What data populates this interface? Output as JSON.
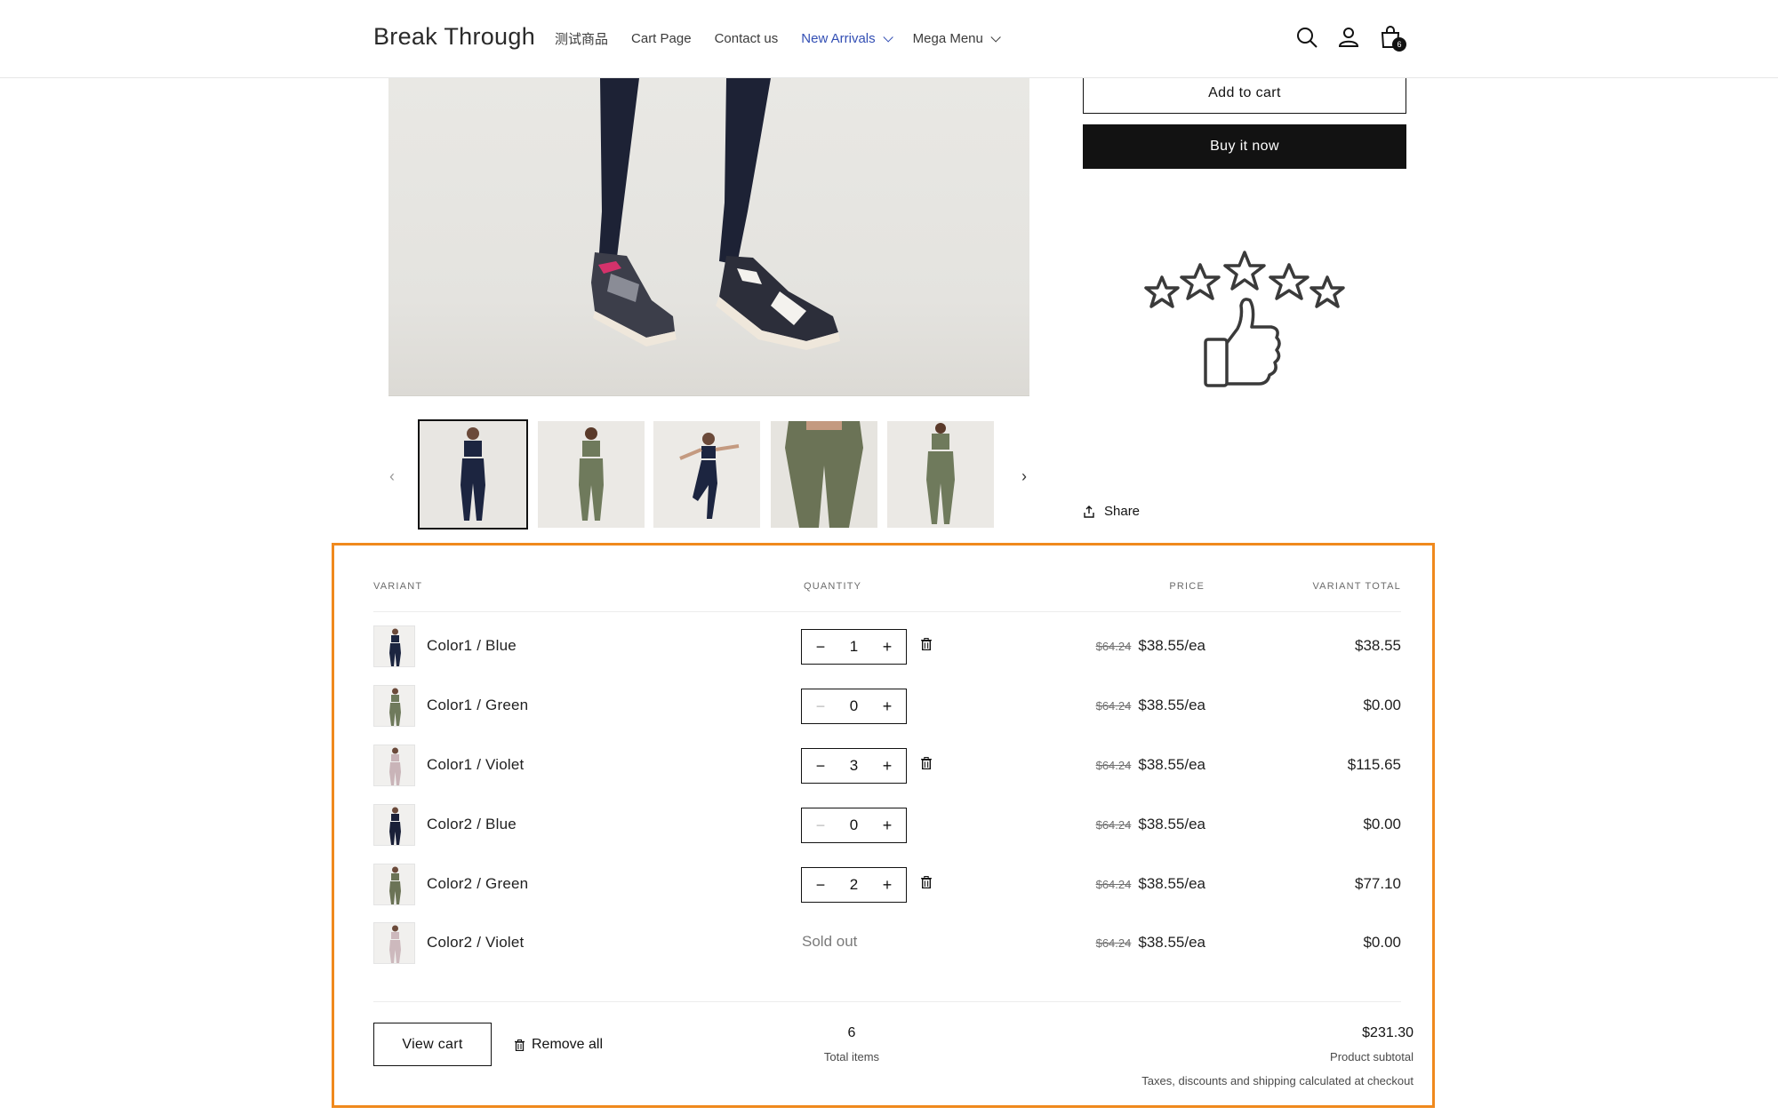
{
  "header": {
    "logo": "Break Through",
    "nav": [
      {
        "label": "测试商品",
        "active": false,
        "dropdown": false
      },
      {
        "label": "Cart Page",
        "active": false,
        "dropdown": false
      },
      {
        "label": "Contact us",
        "active": false,
        "dropdown": false
      },
      {
        "label": "New Arrivals",
        "active": true,
        "dropdown": true
      },
      {
        "label": "Mega Menu",
        "active": false,
        "dropdown": true
      }
    ],
    "icons": [
      "search-icon",
      "account-icon",
      "cart-icon"
    ],
    "cart_count": "6"
  },
  "product": {
    "add_to_cart_label": "Add to cart",
    "buy_now_label": "Buy it now",
    "share_label": "Share",
    "thumbnails": [
      {
        "icon": "navy-outfit-front",
        "selected": true
      },
      {
        "icon": "green-outfit-back",
        "selected": false
      },
      {
        "icon": "navy-outfit-pose",
        "selected": false
      },
      {
        "icon": "green-leggings-closeup",
        "selected": false
      },
      {
        "icon": "green-outfit-back-full",
        "selected": false
      }
    ]
  },
  "bulk": {
    "headers": {
      "variant": "VARIANT",
      "quantity": "QUANTITY",
      "price": "PRICE",
      "variant_total": "VARIANT TOTAL"
    },
    "rows": [
      {
        "name": "Color1 / Blue",
        "qty": "1",
        "sold_out": false,
        "removable": true,
        "old_price": "$64.24",
        "price": "$38.55/ea",
        "total": "$38.55",
        "swatch": "#1c2540"
      },
      {
        "name": "Color1 / Green",
        "qty": "0",
        "sold_out": false,
        "removable": false,
        "old_price": "$64.24",
        "price": "$38.55/ea",
        "total": "$0.00",
        "swatch": "#6f7a5c"
      },
      {
        "name": "Color1 / Violet",
        "qty": "3",
        "sold_out": false,
        "removable": true,
        "old_price": "$64.24",
        "price": "$38.55/ea",
        "total": "$115.65",
        "swatch": "#c9b4b8"
      },
      {
        "name": "Color2 / Blue",
        "qty": "0",
        "sold_out": false,
        "removable": false,
        "old_price": "$64.24",
        "price": "$38.55/ea",
        "total": "$0.00",
        "swatch": "#1a2038"
      },
      {
        "name": "Color2 / Green",
        "qty": "2",
        "sold_out": false,
        "removable": true,
        "old_price": "$64.24",
        "price": "$38.55/ea",
        "total": "$77.10",
        "swatch": "#6b7356"
      },
      {
        "name": "Color2 / Violet",
        "qty": "",
        "sold_out": true,
        "sold_out_label": "Sold out",
        "removable": false,
        "old_price": "$64.24",
        "price": "$38.55/ea",
        "total": "$0.00",
        "swatch": "#cdb9bd"
      }
    ],
    "footer": {
      "view_cart_label": "View cart",
      "remove_all_label": "Remove all",
      "total_items_value": "6",
      "total_items_label": "Total items",
      "subtotal_value": "$231.30",
      "subtotal_label": "Product subtotal",
      "note": "Taxes, discounts and shipping calculated at checkout"
    },
    "accent_border": "#f0891d"
  }
}
